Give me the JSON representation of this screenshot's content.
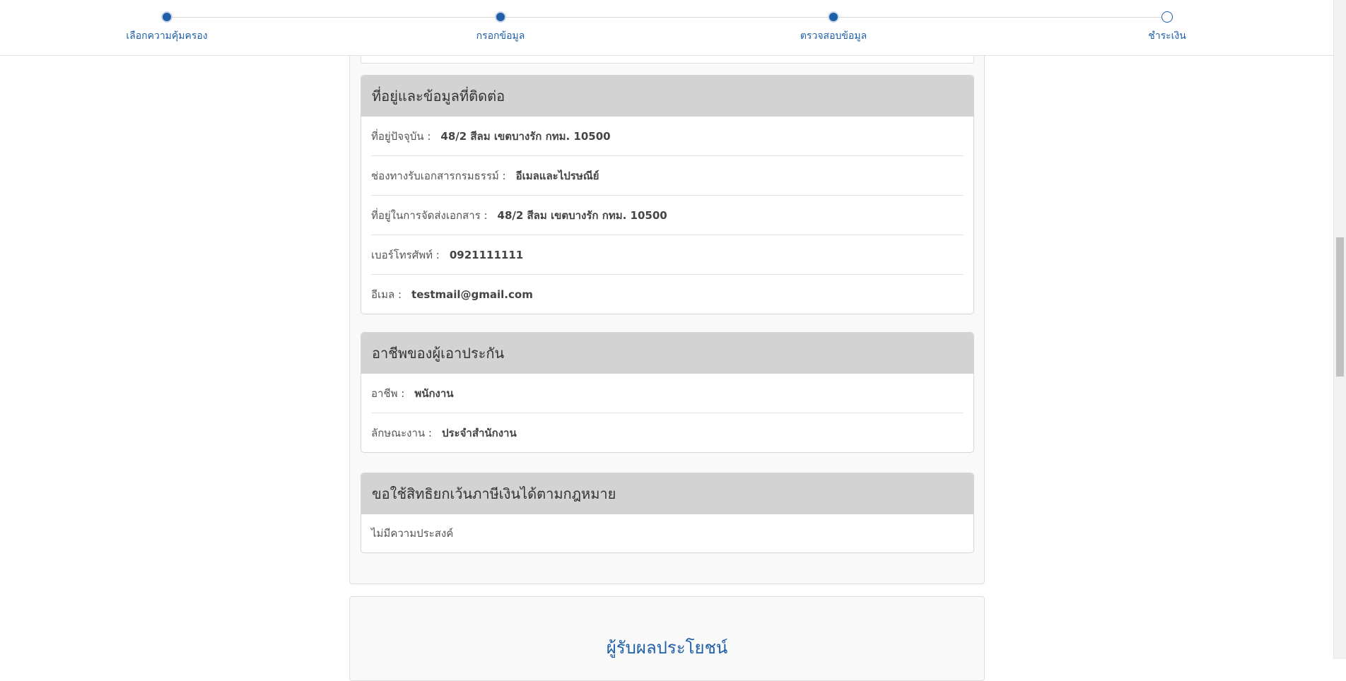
{
  "stepper": {
    "steps": [
      {
        "label": "เลือกความคุ้มครอง",
        "state": "done"
      },
      {
        "label": "กรอกข้อมูล",
        "state": "done"
      },
      {
        "label": "ตรวจสอบข้อมูล",
        "state": "current"
      },
      {
        "label": "ชำระเงิน",
        "state": "pending"
      }
    ]
  },
  "address_card": {
    "title": "ที่อยู่และข้อมูลที่ติดต่อ",
    "rows": [
      {
        "label": "ที่อยู่ปัจจุบัน :",
        "value": "48/2 สีลม เขตบางรัก กทม. 10500"
      },
      {
        "label": "ช่องทางรับเอกสารกรมธรรม์ :",
        "value": "อีเมลและไปรษณีย์"
      },
      {
        "label": "ที่อยู่ในการจัดส่งเอกสาร :",
        "value": "48/2 สีลม เขตบางรัก กทม. 10500"
      },
      {
        "label": "เบอร์โทรศัพท์ :",
        "value": "0921111111"
      },
      {
        "label": "อีเมล :",
        "value": "testmail@gmail.com"
      }
    ]
  },
  "occupation_card": {
    "title": "อาชีพของผู้เอาประกัน",
    "rows": [
      {
        "label": "อาชีพ :",
        "value": "พนักงาน"
      },
      {
        "label": "ลักษณะงาน :",
        "value": "ประจำสำนักงาน"
      }
    ]
  },
  "tax_card": {
    "title": "ขอใช้สิทธิยกเว้นภาษีเงินได้ตามกฎหมาย",
    "text": "ไม่มีความประสงค์"
  },
  "beneficiary": {
    "title": "ผู้รับผลประโยชน์"
  },
  "colors": {
    "accent": "#1f5fa8",
    "card_header": "#d3d3d3",
    "panel_bg": "#f9f9f9"
  }
}
